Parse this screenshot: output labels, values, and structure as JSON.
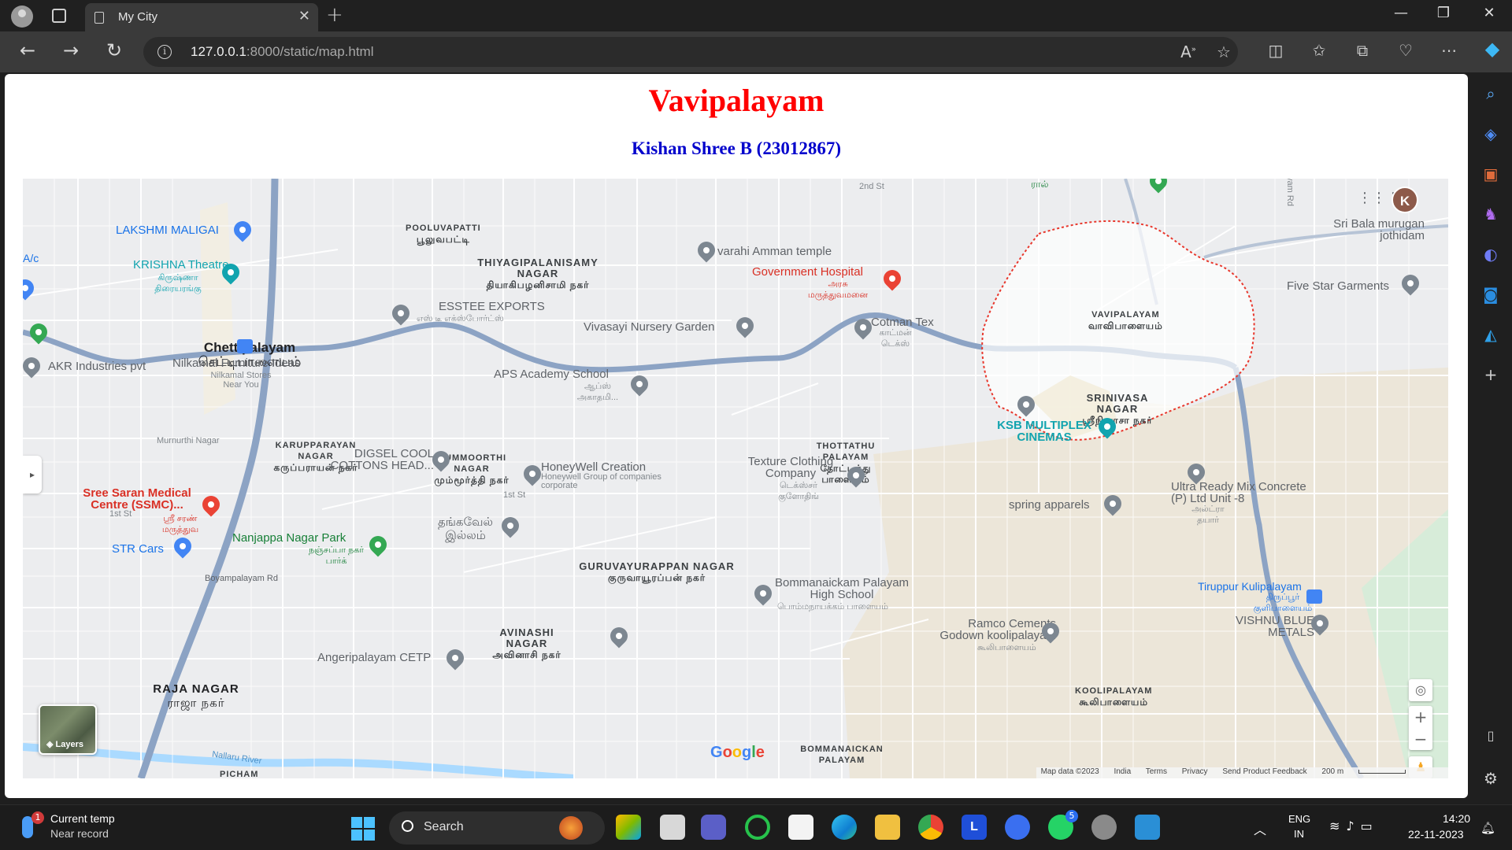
{
  "browser": {
    "tab_title": "My City",
    "url_host": "127.0.0.1",
    "url_rest": ":8000/static/map.html"
  },
  "page": {
    "title": "Vavipalayam",
    "subtitle": "Kishan Shree B (23012867)"
  },
  "map": {
    "places": [
      {
        "id": "pooluvapatti",
        "en": "POOLUVAPATTI",
        "ta": "பூலுவபட்டி"
      },
      {
        "id": "thiyagi",
        "en": "THIYAGIPALANISAMY NAGAR",
        "ta": "தியாகிபழனிசாமி நகர்"
      },
      {
        "id": "vavipalayam",
        "en": "VAVIPALAYAM",
        "ta": "வாவிபாளையம்"
      },
      {
        "id": "srinivasa",
        "en": "SRINIVASA NAGAR",
        "ta": "ஸ்ரீநிவாசா நகர்"
      },
      {
        "id": "karuppa",
        "en": "KARUPPARAYAN NAGAR",
        "ta": "கருப்பராயன் நகர்"
      },
      {
        "id": "mummoorthi",
        "en": "MUMMOORTHI NAGAR",
        "ta": "மும்மூர்த்தி நகர்"
      },
      {
        "id": "thottathu",
        "en": "THOTTATHU PALAYAM",
        "ta": "தோட்டத்து பாளையம்"
      },
      {
        "id": "guruvayur",
        "en": "GURUVAYURAPPAN NAGAR",
        "ta": "குருவாயூரப்பன் நகர்"
      },
      {
        "id": "avinashi",
        "en": "AVINASHI NAGAR",
        "ta": "அவினாசி நகர்"
      },
      {
        "id": "koolipalayam",
        "en": "KOOLIPALAYAM",
        "ta": "கூலிபாளையம்"
      },
      {
        "id": "bommanaickan",
        "en": "BOMMANAICKAN PALAYAM",
        "ta": ""
      },
      {
        "id": "pichampalayam",
        "en": "PICHAM",
        "ta": ""
      }
    ],
    "towns": [
      {
        "id": "chettipalayam",
        "en": "Chettipalayam",
        "ta": "செட்டிபாளையம்"
      },
      {
        "id": "rajanagar",
        "en": "RAJA NAGAR",
        "ta": "ராஜா நகர்"
      }
    ],
    "pois": {
      "lakshmi": "LAKSHMI MALIGAI",
      "krishna": "KRISHNA Theatre",
      "krishna_ta": "கிருஷ்ணா திரையரங்கு",
      "varahi": "varahi Amman temple",
      "govt_hospital": "Government Hospital",
      "govt_hospital_ta": "அரசு மருத்துவமனை",
      "sri_bala": "Sri Bala murugan jothidam",
      "five_star": "Five Star Garments",
      "esstee": "ESSTEE EXPORTS",
      "esstee_ta": "எஸ் டீ எக்ஸ்போர்ட்ஸ்",
      "vivasayi": "Vivasayi Nursery Garden",
      "cotman": "Cotman Tex",
      "cotman_ta": "காட்மன் டெக்ஸ்",
      "akr": "AKR Industries pvt",
      "nilkamal": "Nilkamal Furniture Ideas",
      "nilkamal_sub": "Nilkamal Stores Near You",
      "aps": "APS Academy School",
      "aps_ta": "ஆப்ஸ் அகாதமி...",
      "ksb": "KSB MULTIPLEX CINEMAS",
      "digsel": "DIGSEL COOL COTTONS HEAD...",
      "honeywell": "HoneyWell Creation",
      "honeywell_sub": "Honeywell Group of companies corporate",
      "texture": "Texture Clothing Company",
      "texture_ta": "டெக்ஸ்சர் குளோதிங்",
      "sree_saran": "Sree Saran Medical Centre (SSMC)...",
      "sree_saran_ta": "ஸ்ரீ சரண் மருத்துவ",
      "ultra": "Ultra Ready Mix Concrete (P) Ltd Unit -8",
      "ultra_ta": "அல்ட்ரா தயார்",
      "spring": "spring apparels",
      "thangavel": "தங்கவேல் இல்லம்",
      "nanjappa": "Nanjappa Nagar Park",
      "nanjappa_ta": "நஞ்சப்பா நகர் பார்க்",
      "str": "STR Cars",
      "bommanaickam_school": "Bommanaickam Palayam High School",
      "bommanaickam_ta": "பொம்மநாயக்கம் பாளையம்",
      "tiruppur_kuli": "Tiruppur Kulipalayam",
      "tiruppur_kuli_ta": "திருப்பூர் குளிபாளையம்",
      "vishnu": "VISHNU BLUE METALS",
      "ramco": "Ramco Cements Godown koolipalayam",
      "ramco_ta": "கூலிபாளையம்",
      "angeripalayam": "Angeripalayam CETP",
      "ac_partial": "A/c",
      "top_partial": "ரால்",
      "murthi": "Murnurthi Nagar"
    },
    "roads": {
      "second_st": "2nd St",
      "first_st_a": "1st St",
      "first_st_b": "1st St",
      "boyampalayam": "Boyampalayam Rd",
      "nallaru": "Nallaru River",
      "yam_rd": "yam Rd"
    },
    "layers_label": "Layers",
    "account_initial": "K",
    "google_letters": [
      "G",
      "o",
      "o",
      "g",
      "l",
      "e"
    ],
    "attribution": {
      "map_data": "Map data ©2023",
      "india": "India",
      "terms": "Terms",
      "privacy": "Privacy",
      "feedback": "Send Product Feedback",
      "scale": "200 m"
    }
  },
  "taskbar": {
    "weather_line1": "Current temp",
    "weather_line2": "Near record",
    "weather_badge": "1",
    "search_label": "Search",
    "whatsapp_badge": "5",
    "lang1": "ENG",
    "lang2": "IN",
    "time": "14:20",
    "date": "22-11-2023"
  }
}
